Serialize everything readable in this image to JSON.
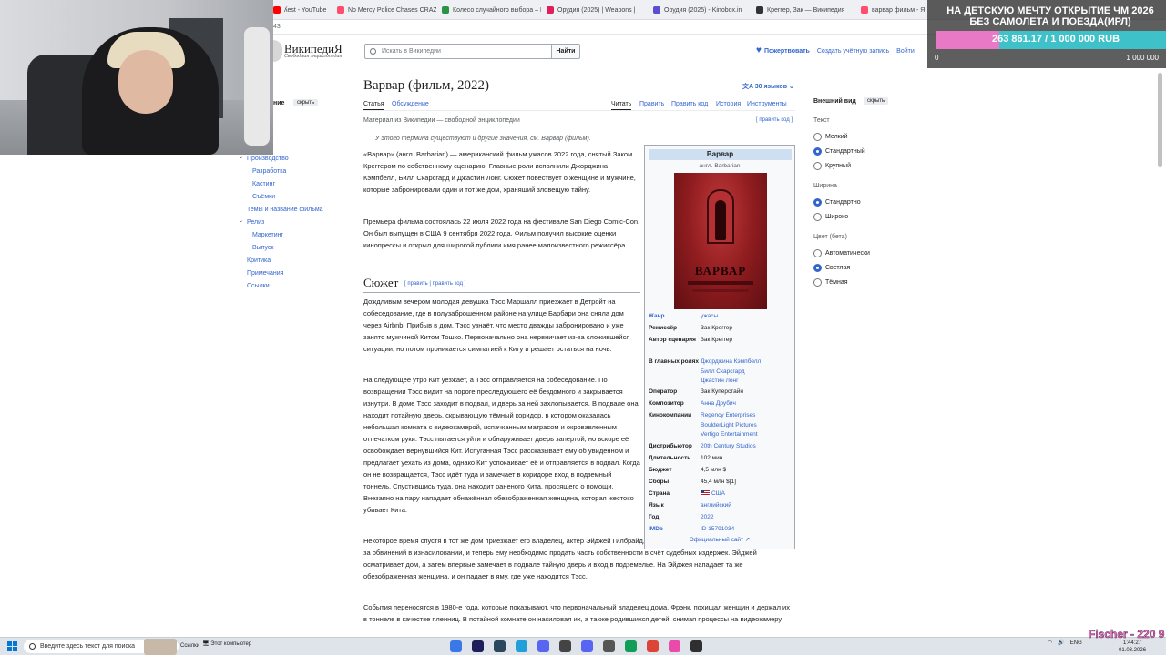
{
  "browser": {
    "tabs": [
      {
        "label": "ʎest - YouTube",
        "color": "#ff0000"
      },
      {
        "label": "No Mercy Police Chases CRAZY",
        "color": "#ff4d6d"
      },
      {
        "label": "Колесо случайного выбора – Р",
        "color": "#2b9348"
      },
      {
        "label": "Орудия (2025) | Weapons |",
        "color": "#e01e5a"
      },
      {
        "label": "Орудия (2025) - Kinobox.in",
        "color": "#5a4fcf"
      },
      {
        "label": "Креггер, Зак — Википедия",
        "color": "#333333"
      },
      {
        "label": "варвар фильм - Яндекс",
        "color": "#ff4d6d"
      }
    ],
    "address_fragment": "43"
  },
  "donation": {
    "title": "НА ДЕТСКУЮ МЕЧТУ ОТКРЫТИЕ ЧМ 2026 БЕЗ САМОЛЕТА И ПОЕЗДА(ИРЛ)",
    "amount": "263 861.17 / 1 000 000 RUB",
    "progress": 0.264,
    "min": "0",
    "max": "1 000 000",
    "fill_color": "#e879c7",
    "track_color": "#3fc1c9"
  },
  "wiki": {
    "logo_name": "ВикипедиЯ",
    "logo_tag": "Свободная энциклопедия",
    "search_placeholder": "Искать в Википедии",
    "search_button": "Найти",
    "donate": "Пожертвовать",
    "create_account": "Создать учётную запись",
    "login": "Войти"
  },
  "toc": {
    "head": "ние",
    "hide": "скрыть",
    "items": [
      {
        "label": "Производство",
        "chevron": true
      },
      {
        "label": "Разработка"
      },
      {
        "label": "Кастинг"
      },
      {
        "label": "Съёмки"
      },
      {
        "label": "Темы и название фильма"
      },
      {
        "label": "Релиз",
        "chevron": true
      },
      {
        "label": "Маркетинг"
      },
      {
        "label": "Выпуск"
      },
      {
        "label": "Критика"
      },
      {
        "label": "Примечания"
      },
      {
        "label": "Ссылки"
      }
    ]
  },
  "article": {
    "title": "Варвар (фильм, 2022)",
    "languages": "30 языков",
    "tabs_left": [
      "Статья",
      "Обсуждение"
    ],
    "tabs_right": [
      "Читать",
      "Править",
      "Править код",
      "История",
      "Инструменты"
    ],
    "from": "Материал из Википедии — свободной энциклопедии",
    "edit_code": "[ править код ]",
    "hatnote": "У этого термина существуют и другие значения, см. Варвар (фильм).",
    "intro_1": "«Варвар» (англ. Barbarian) — американский фильм ужасов 2022 года, снятый Заком Креггером по собственному сценарию. Главные роли исполнили Джорджина Кэмпбелл, Билл Скарсгард и Джастин Лонг. Сюжет повествует о женщине и мужчине, которые забронировали один и тот же дом, хранящий зловещую тайну.",
    "intro_2": "Премьера фильма состоялась 22 июля 2022 года на фестивале San Diego Comic-Con. Он был выпущен в США 9 сентября 2022 года. Фильм получил высокие оценки кинопрессы и открыл для широкой публики имя ранее малоизвестного режиссёра.",
    "plot_heading": "Сюжет",
    "plot_edit": "[ править | править код ]",
    "plot_1": "Дождливым вечером молодая девушка Тэсс Маршалл приезжает в Детройт на собеседование, где в полузаброшенном районе на улице Барбари она сняла дом через Airbnb. Прибыв в дом, Тэсс узнаёт, что место дважды забронировано и уже занято мужчиной Китом Тошко. Первоначально она нервничает из-за сложившейся ситуации, но потом проникается симпатией к Киту и решает остаться на ночь.",
    "plot_2": "На следующее утро Кит уезжает, а Тэсс отправляется на собеседование. По возвращении Тэсс видит на пороге преследующего её бездомного и закрывается изнутри. В доме Тэсс заходит в подвал, и дверь за ней захлопывается. В подвале она находит потайную дверь, скрывающую тёмный коридор, в котором оказалась небольшая комната с видеокамерой, испачканным матрасом и окровавленным отпечатком руки. Тэсс пытается уйти и обнаруживает дверь запертой, но вскоре её освобождает вернувшийся Кит. Испуганная Тэсс рассказывает ему об увиденном и предлагает уехать из дома, однако Кит успокаивает её и отправляется в подвал. Когда он не возвращается, Тэсс идёт туда и замечает в коридоре вход в подземный тоннель. Спустившись туда, она находит раненого Кита, просящего о помощи. Внезапно на пару нападает обнажённая обезображенная женщина, которая жестоко убивает Кита.",
    "plot_3": "Некоторое время спустя в тот же дом приезжает его владелец, актёр Эйджей Гилбрайд, которого недавно уволили из телесериала из-за обвинений в изнасиловании, и теперь ему необходимо продать часть собственности в счёт судебных издержек. Эйджей осматривает дом, а затем впервые замечает в подвале тайную дверь и вход в подземелье. На Эйджея нападает та же обезображенная женщина, и он падает в яму, где уже находится Тэсс.",
    "plot_4": "События переносятся в 1980-е года, которые показывают, что первоначальный владелец дома, Фрэнк, похищал женщин и держал их в тоннеле в качестве пленниц. В потайной комнате он насиловал их, а также родившихся детей, снимая процессы на видеокамеру"
  },
  "infobox": {
    "title": "Варвар",
    "original": "англ. Barbarian",
    "poster_title": "ВАРВАР",
    "rows": [
      {
        "label": "Жанр",
        "value": "ужасы",
        "link": true,
        "label_link": true
      },
      {
        "label": "Режиссёр",
        "value": "Зак Креггер"
      },
      {
        "label": "Автор сценария",
        "value": "Зак Креггер"
      },
      {
        "label": "В главных ролях",
        "value": "Джорджина Кэмпбелл\nБилл Скарсгард\nДжастин Лонг",
        "link": true
      },
      {
        "label": "Оператор",
        "value": "Зак Куперстайн"
      },
      {
        "label": "Композитор",
        "value": "Анна Друбич",
        "link": true
      },
      {
        "label": "Кинокомпании",
        "value": "Regency Enterprises\nBoulderLight Pictures\nVertigo Entertainment",
        "link": true
      },
      {
        "label": "Дистрибьютор",
        "value": "20th Century Studios",
        "link": true
      },
      {
        "label": "Длительность",
        "value": "102 мин"
      },
      {
        "label": "Бюджет",
        "value": "4,5 млн $"
      },
      {
        "label": "Сборы",
        "value": "45,4 млн $[1]"
      },
      {
        "label": "Страна",
        "value": "США",
        "link": true
      },
      {
        "label": "Язык",
        "value": "английский",
        "link": true
      },
      {
        "label": "Год",
        "value": "2022",
        "link": true
      },
      {
        "label": "IMDb",
        "value": "ID 15791034",
        "link": true,
        "label_link": true
      }
    ],
    "site": "Официальный сайт ↗"
  },
  "appearance": {
    "head": "Внешний вид",
    "hide": "скрыть",
    "sections": [
      {
        "title": "Текст",
        "options": [
          "Мелкий",
          "Стандартный",
          "Крупный"
        ],
        "selected": 1
      },
      {
        "title": "Ширина",
        "options": [
          "Стандартно",
          "Широко"
        ],
        "selected": 0
      },
      {
        "title": "Цвет (бета)",
        "options": [
          "Автоматически",
          "Светлая",
          "Тёмная"
        ],
        "selected": 1
      }
    ]
  },
  "taskbar": {
    "search_placeholder": "Введите здесь текст для поиска",
    "links": "Ссылки",
    "pc": "Этот компьютер",
    "lang": "ENG",
    "time": "1:44:27",
    "date": "01.03.2026",
    "apps": [
      "#3b78e7",
      "#1e1e5a",
      "#2a475e",
      "#229ed9",
      "#5865f2",
      "#444444",
      "#5865f2",
      "#555555",
      "#0f9d58",
      "#db4437",
      "#ea4aaa",
      "#2f2f2f"
    ]
  },
  "overlay_name": "Fischer - 220 9"
}
